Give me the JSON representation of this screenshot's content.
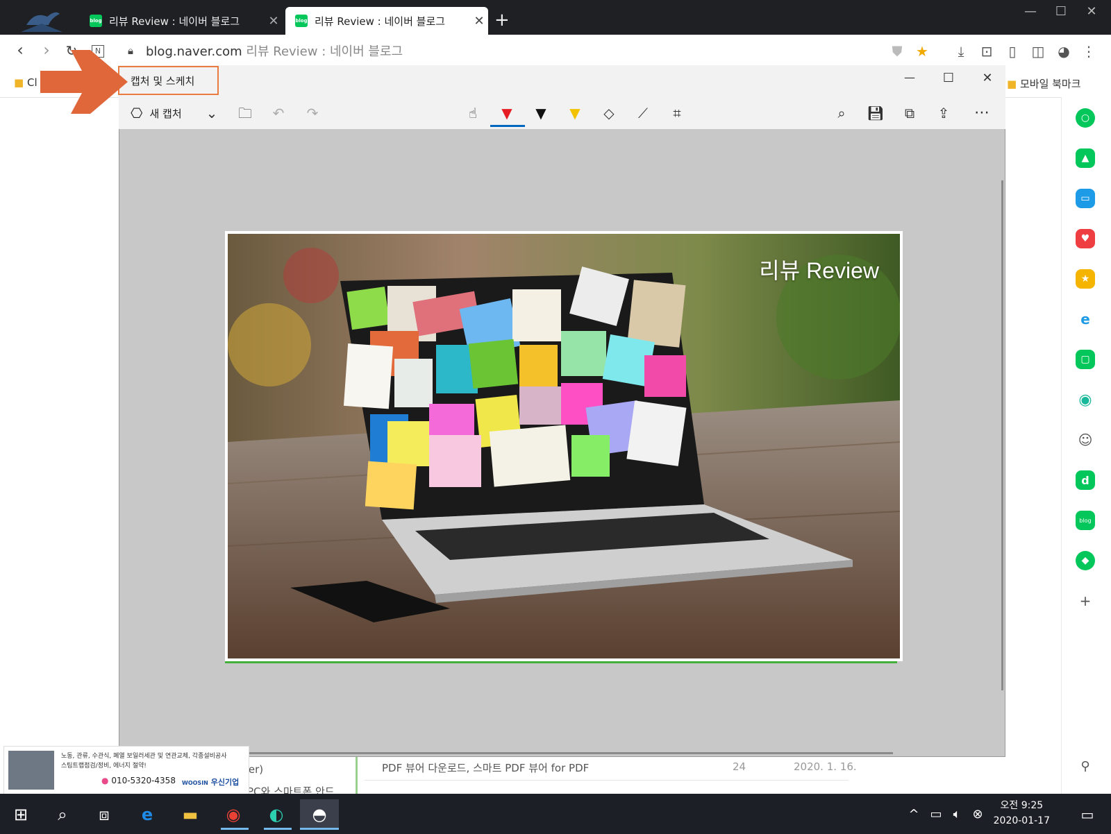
{
  "browser": {
    "tabs": [
      {
        "title": "리뷰 Review : 네이버 블로그",
        "active": false
      },
      {
        "title": "리뷰 Review : 네이버 블로그",
        "active": true
      }
    ],
    "new_tab": "+",
    "window_controls": {
      "minimize": "—",
      "maximize": "☐",
      "close": "✕"
    },
    "url_host": "blog.naver.com",
    "url_title": "리뷰 Review : 네이버 블로그",
    "bookmark_left": "Cl",
    "bookmark_right": "모바일 북마크"
  },
  "snip": {
    "app_title": "캡처 및 스케치",
    "new_capture": "새 캡처",
    "window_controls": {
      "minimize": "—",
      "maximize": "☐",
      "close": "✕"
    },
    "photo_title": "리뷰 Review"
  },
  "page": {
    "row1_title": "PDF 뷰어 다운로드, 스마트 PDF 뷰어 for PDF",
    "row1_count": "24",
    "row1_date": "2020. 1. 16.",
    "left_fragment": "ter)",
    "row2_fragment": "PC와 스마트폰 안드"
  },
  "ad": {
    "line1": "노동, 관류, 수관식, 폐열 보일러세관 및 연관교체, 각종설비공사",
    "line2": "스팀트랩점검/정비, 에너지 절약!",
    "phone": "010-5320-4358",
    "brand_en": "WOOSIN",
    "brand_ko": "우신기업"
  },
  "taskbar": {
    "time": "오전 9:25",
    "date": "2020-01-17"
  },
  "colors": {
    "annotation_orange": "#e0673a",
    "naver_green": "#03c75a",
    "taskbar": "#1d1f27"
  }
}
